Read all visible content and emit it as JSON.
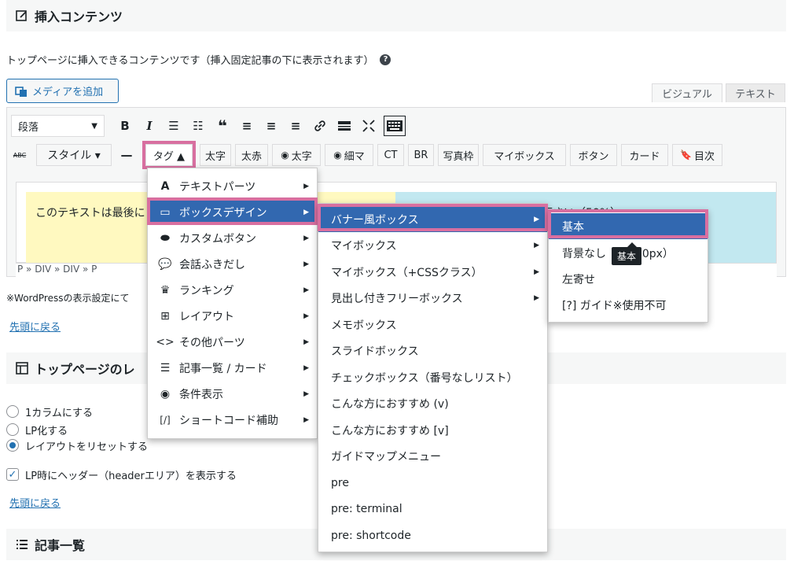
{
  "section1": {
    "title": "挿入コンテンツ",
    "description": "トップページに挿入できるコンテンツです（挿入固定記事の下に表示されます）",
    "help": "?"
  },
  "media_button": "メディアを追加",
  "tabs": {
    "visual": "ビジュアル",
    "text": "テキスト"
  },
  "toolbar1": {
    "format": "段落",
    "buttons": [
      "B",
      "I",
      "☰",
      "☷",
      "❝",
      "≡",
      "≡",
      "≡",
      "🔗",
      "▬",
      "⤢",
      "⌨"
    ]
  },
  "toolbar2": {
    "strike": "ABC",
    "style": "スタイル ▾",
    "hr": "—",
    "tag": "タグ ▲",
    "buttons": [
      "太字",
      "太赤",
      "太字",
      "細マ",
      "CT",
      "BR",
      "写真枠",
      "マイボックス",
      "ボタン",
      "カード",
      "目次"
    ]
  },
  "content": {
    "text": "このテキストは最後に",
    "text_right": "下さい（50%）"
  },
  "path": "P » DIV » DIV » P",
  "note": "※WordPressの表示設定にて",
  "back_link": "先頭に戻る",
  "section2": {
    "title": "トップページのレ"
  },
  "radios": [
    "1カラムにする",
    "LP化する",
    "レイアウトをリセットする"
  ],
  "checkbox": "LP時にヘッダー（headerエリア）を表示する",
  "back_link2": "先頭に戻る",
  "section3": {
    "title": "記事一覧"
  },
  "menu1": {
    "items": [
      "テキストパーツ",
      "ボックスデザイン",
      "カスタムボタン",
      "会話ふきだし",
      "ランキング",
      "レイアウト",
      "その他パーツ",
      "記事一覧 / カード",
      "条件表示",
      "ショートコード補助"
    ],
    "icons": [
      "A",
      "▭",
      "⬬",
      "💬",
      "♛",
      "⊞",
      "<>",
      "☰",
      "◉",
      "[/]"
    ]
  },
  "menu2": {
    "items": [
      "バナー風ボックス",
      "マイボックス",
      "マイボックス（+CSSクラス）",
      "見出し付きフリーボックス",
      "メモボックス",
      "スライドボックス",
      "チェックボックス（番号なしリスト）",
      "こんな方におすすめ (v)",
      "こんな方におすすめ [v]",
      "ガイドマップメニュー",
      "pre",
      "pre: terminal",
      "pre: shortcode"
    ]
  },
  "menu3": {
    "items": [
      "基本",
      "背景なし（幅400px）",
      "左寄せ",
      "[?] ガイド※使用不可"
    ]
  },
  "tooltip": "基本",
  "colors": {
    "accent": "#2271b1",
    "menu_active": "#3268b0",
    "highlight": "#d86fa0"
  }
}
